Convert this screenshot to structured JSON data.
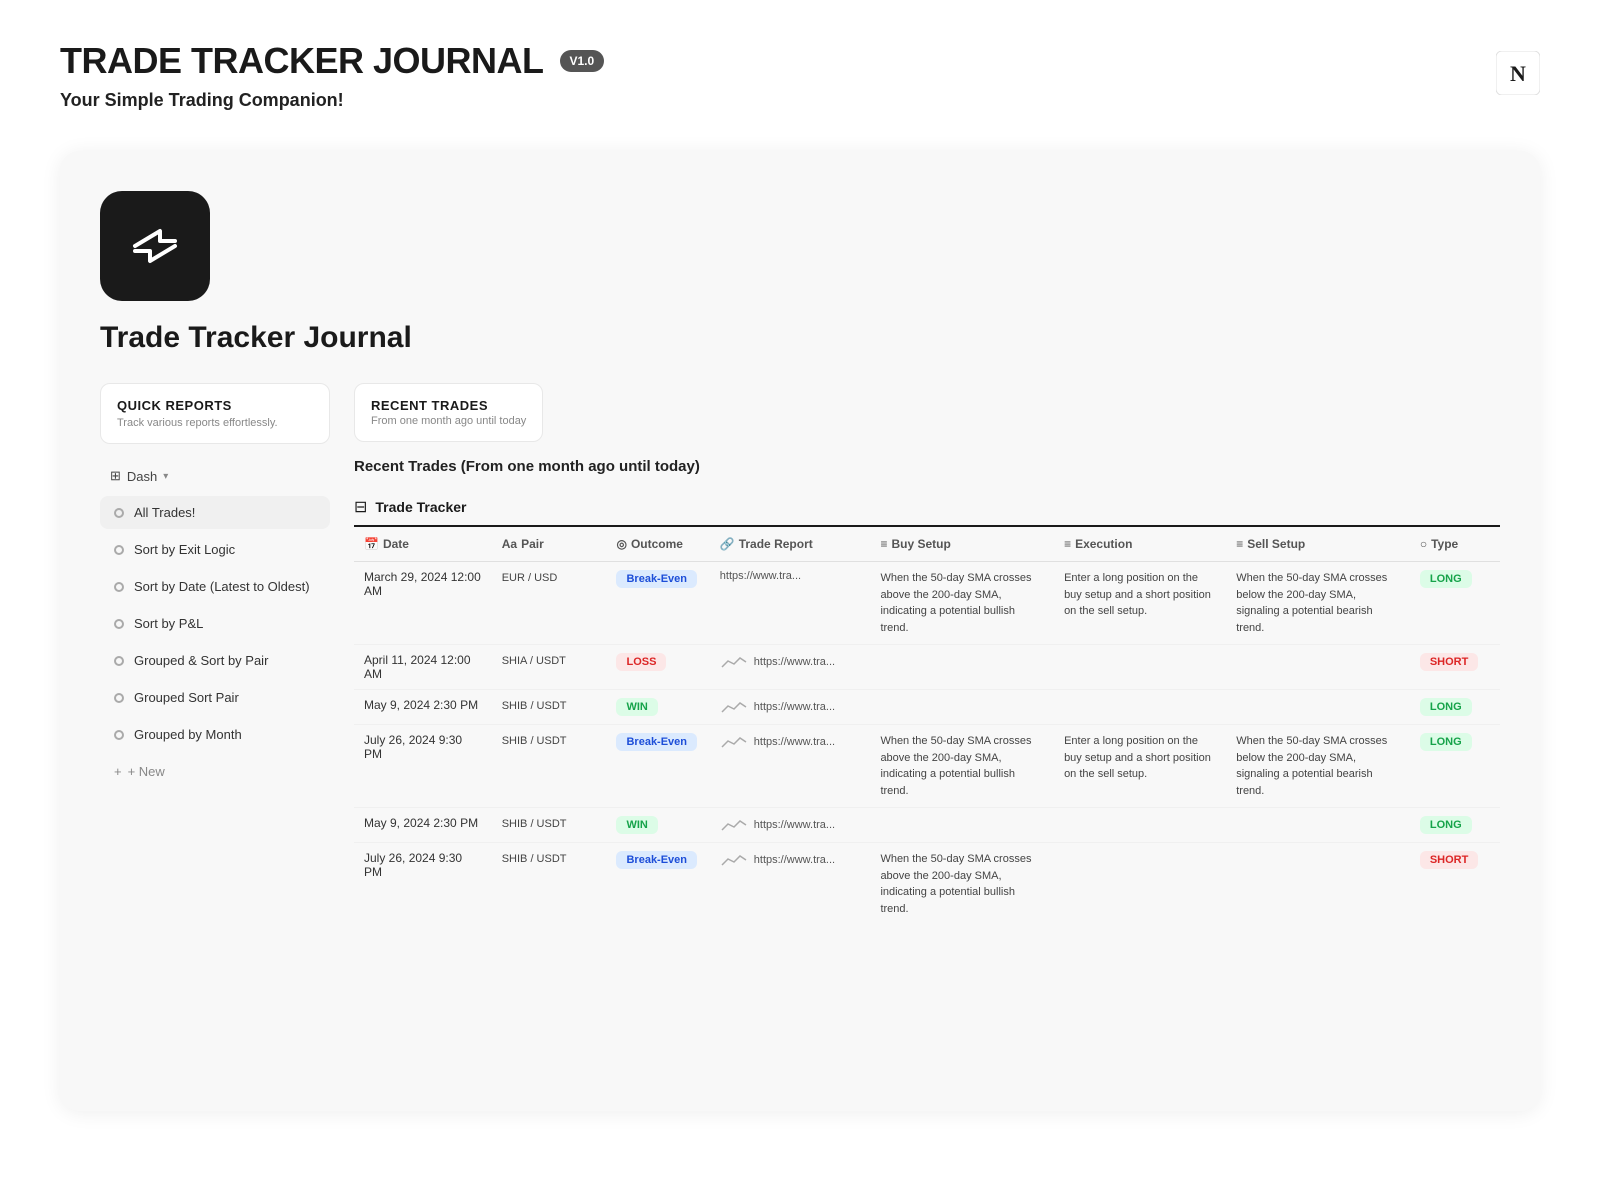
{
  "header": {
    "title": "TRADE TRACKER JOURNAL",
    "version": "V1.0",
    "subtitle": "Your Simple Trading Companion!"
  },
  "notion_icon": "N",
  "app": {
    "name": "Trade Tracker Journal"
  },
  "sidebar": {
    "quick_reports_title": "QUICK REPORTS",
    "quick_reports_subtitle": "Track various reports effortlessly.",
    "dash_label": "Dash",
    "items": [
      {
        "label": "All Trades!",
        "active": true
      },
      {
        "label": "Sort by Exit Logic"
      },
      {
        "label": "Sort by Date (Latest to Oldest)"
      },
      {
        "label": "Sort by P&L"
      },
      {
        "label": "Grouped & Sort by Pair"
      },
      {
        "label": "Grouped Sort Pair"
      },
      {
        "label": "Grouped by Month"
      }
    ],
    "new_label": "+ New"
  },
  "main": {
    "recent_trades_title": "RECENT TRADES",
    "recent_trades_subtitle": "From one month ago until today",
    "section_title": "Recent Trades (From one month ago until today)",
    "trade_tracker_label": "Trade Tracker",
    "table": {
      "columns": [
        "Date",
        "Aa Pair",
        "Outcome",
        "Trade Report",
        "Buy Setup",
        "Execution",
        "Sell Setup",
        "Type"
      ],
      "rows": [
        {
          "date": "March 29, 2024 12:00 AM",
          "pair": "EUR / USD",
          "outcome": "Break-Even",
          "outcome_type": "break-even",
          "report_link": "https://www.tra...",
          "has_chart": false,
          "buy_setup": "When the 50-day SMA crosses above the 200-day SMA, indicating a potential bullish trend.",
          "execution": "Enter a long position on the buy setup and a short position on the sell setup.",
          "sell_setup": "When the 50-day SMA crosses below the 200-day SMA, signaling a potential bearish trend.",
          "type": "LONG",
          "type_class": "long"
        },
        {
          "date": "April 11, 2024 12:00 AM",
          "pair": "SHIA / USDT",
          "outcome": "LOSS",
          "outcome_type": "loss",
          "report_link": "https://www.tra...",
          "has_chart": true,
          "buy_setup": "",
          "execution": "",
          "sell_setup": "",
          "type": "SHORT",
          "type_class": "short"
        },
        {
          "date": "May 9, 2024 2:30 PM",
          "pair": "SHIB / USDT",
          "outcome": "WIN",
          "outcome_type": "win",
          "report_link": "https://www.tra...",
          "has_chart": true,
          "buy_setup": "",
          "execution": "",
          "sell_setup": "",
          "type": "LONG",
          "type_class": "long"
        },
        {
          "date": "July 26, 2024 9:30 PM",
          "pair": "SHIB / USDT",
          "outcome": "Break-Even",
          "outcome_type": "break-even",
          "report_link": "https://www.tra...",
          "has_chart": true,
          "buy_setup": "When the 50-day SMA crosses above the 200-day SMA, indicating a potential bullish trend.",
          "execution": "Enter a long position on the buy setup and a short position on the sell setup.",
          "sell_setup": "When the 50-day SMA crosses below the 200-day SMA, signaling a potential bearish trend.",
          "type": "LONG",
          "type_class": "long"
        },
        {
          "date": "May 9, 2024 2:30 PM",
          "pair": "SHIB / USDT",
          "outcome": "WIN",
          "outcome_type": "win",
          "report_link": "https://www.tra...",
          "has_chart": true,
          "buy_setup": "",
          "execution": "",
          "sell_setup": "",
          "type": "LONG",
          "type_class": "long"
        },
        {
          "date": "July 26, 2024 9:30 PM",
          "pair": "SHIB / USDT",
          "outcome": "Break-Even",
          "outcome_type": "break-even",
          "report_link": "https://www.tra...",
          "has_chart": true,
          "buy_setup": "When the 50-day SMA crosses above the 200-day SMA, indicating a potential bullish trend.",
          "execution": "",
          "sell_setup": "",
          "type": "SHORT",
          "type_class": "short"
        }
      ]
    }
  }
}
